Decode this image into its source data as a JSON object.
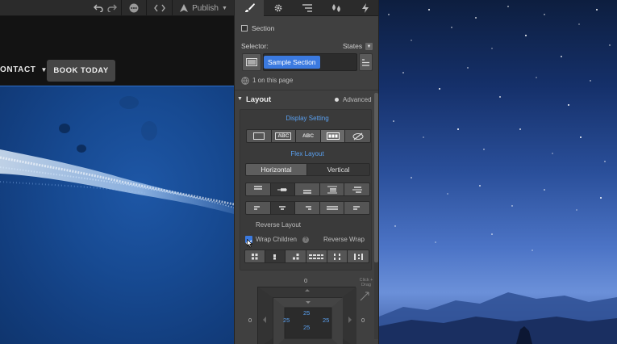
{
  "toolbar": {
    "publish_label": "Publish"
  },
  "site_nav": {
    "contact_label": "ONTACT",
    "book_label": "BOOK TODAY"
  },
  "panel": {
    "section_label": "Section",
    "selector_label": "Selector:",
    "states_label": "States",
    "selector_tag": "Sample Section",
    "on_page": "1 on this page",
    "layout_title": "Layout",
    "advanced_label": "Advanced",
    "display_setting": "Display Setting",
    "display_options": [
      "ABC",
      "ABC"
    ],
    "flex_layout": "Flex Layout",
    "horizontal": "Horizontal",
    "vertical": "Vertical",
    "reverse_layout": "Reverse Layout",
    "wrap_children": "Wrap Children",
    "reverse_wrap": "Reverse Wrap",
    "spacing": {
      "margin_top": "0",
      "margin_left": "0",
      "margin_right": "0",
      "padding_top": "25",
      "padding_left": "25",
      "padding_right": "25",
      "padding_bottom": "25",
      "click_drag": "Click + Drag"
    }
  },
  "colors": {
    "panel_bg": "#404040",
    "accent_blue": "#3b7ae0",
    "text_blue": "#5aa0f0"
  }
}
